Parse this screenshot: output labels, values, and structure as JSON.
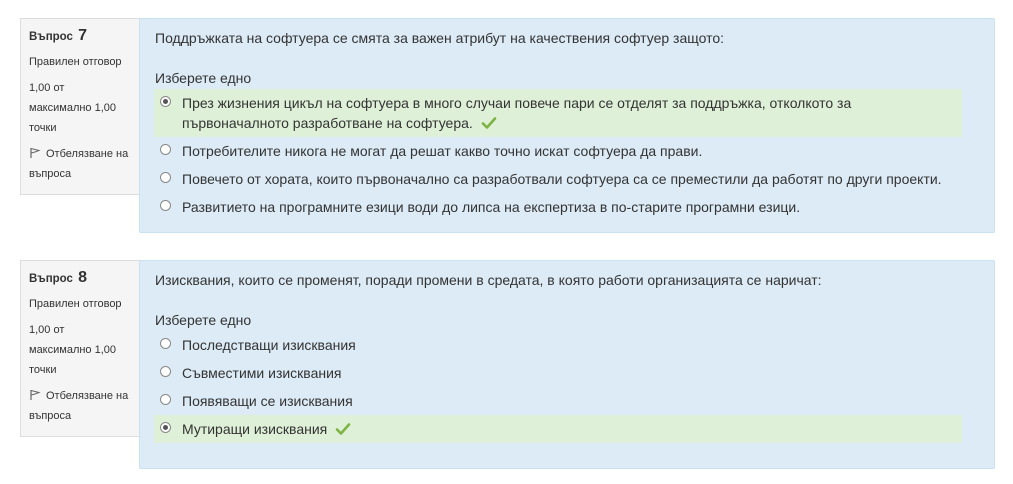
{
  "questions": [
    {
      "label": "Въпрос",
      "number": "7",
      "state": "Правилен отговор",
      "grade": "1,00 от максимално 1,00 точки",
      "flag_label": "Отбелязване на въпроса",
      "text": "Поддръжката на софтуера се смята за важен атрибут на качествения софтуер защото:",
      "prompt": "Изберете едно",
      "options": [
        {
          "label": "През жизнения цикъл на софтуера в много случаи повече пари се отделят за поддръжка, отколкото за първоначалното разработване на софтуера.",
          "selected": true,
          "correct": true
        },
        {
          "label": "Потребителите никога не могат да решат какво точно искат софтуера да прави.",
          "selected": false,
          "correct": false
        },
        {
          "label": "Повечето от хората, които първоначално са разработвали софтуера са се преместили да работят по други проекти.",
          "selected": false,
          "correct": false
        },
        {
          "label": "Развитието на програмните езици води до липса на експертиза в по-старите програмни езици.",
          "selected": false,
          "correct": false
        }
      ]
    },
    {
      "label": "Въпрос",
      "number": "8",
      "state": "Правилен отговор",
      "grade": "1,00 от максимално 1,00 точки",
      "flag_label": "Отбелязване на въпроса",
      "text": "Изисквания, които се променят, поради промени в средата, в която работи организацията се наричат:",
      "prompt": "Изберете едно",
      "options": [
        {
          "label": "Последстващи изисквания",
          "selected": false,
          "correct": false
        },
        {
          "label": "Съвместими изисквания",
          "selected": false,
          "correct": false
        },
        {
          "label": "Появяващи се изисквания",
          "selected": false,
          "correct": false
        },
        {
          "label": "Мутиращи изисквания",
          "selected": true,
          "correct": true
        }
      ]
    }
  ],
  "colors": {
    "correct_bg": "#dff0d8",
    "content_bg": "#dcebf6",
    "tick": "#7cb342"
  },
  "icons": {
    "flag": "flag-icon",
    "tick": "checkmark-icon"
  }
}
